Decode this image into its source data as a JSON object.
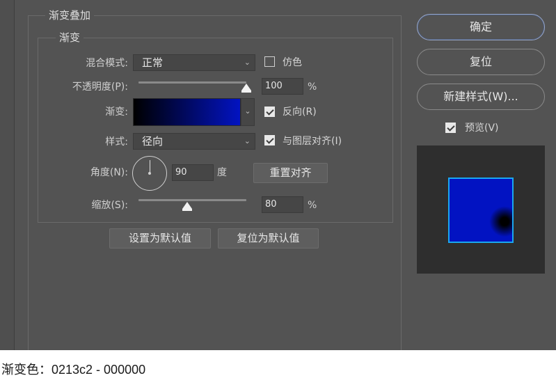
{
  "dialog": {
    "section_title": "渐变叠加",
    "subsection_title": "渐变",
    "blend_mode": {
      "label": "混合模式:",
      "value": "正常"
    },
    "dither": {
      "label": "仿色",
      "checked": false
    },
    "opacity": {
      "label": "不透明度(P):",
      "value": "100",
      "unit": "%",
      "level": 1.0
    },
    "gradient": {
      "label": "渐变:",
      "from_color": "#000000",
      "to_color": "#0213c2"
    },
    "reverse": {
      "label": "反向(R)",
      "checked": true
    },
    "style": {
      "label": "样式:",
      "value": "径向"
    },
    "align_with_layer": {
      "label": "与图层对齐(I)",
      "checked": true
    },
    "angle": {
      "label": "角度(N):",
      "value": "90",
      "unit": "度"
    },
    "reset_alignment_label": "重置对齐",
    "scale": {
      "label": "缩放(S):",
      "value": "80",
      "unit": "%",
      "level": 0.45
    },
    "make_default_label": "设置为默认值",
    "reset_default_label": "复位为默认值"
  },
  "buttons": {
    "ok_label": "确定",
    "reset_label": "复位",
    "new_style_label": "新建样式(W)..."
  },
  "preview": {
    "label": "预览(V)",
    "checked": true
  },
  "caption": "渐变色：0213c2 - 000000",
  "colors": {
    "dialog_bg": "#535353",
    "field_bg": "#464646",
    "gradient_blue": "#0213c2",
    "preview_border": "#1aa8f0"
  }
}
